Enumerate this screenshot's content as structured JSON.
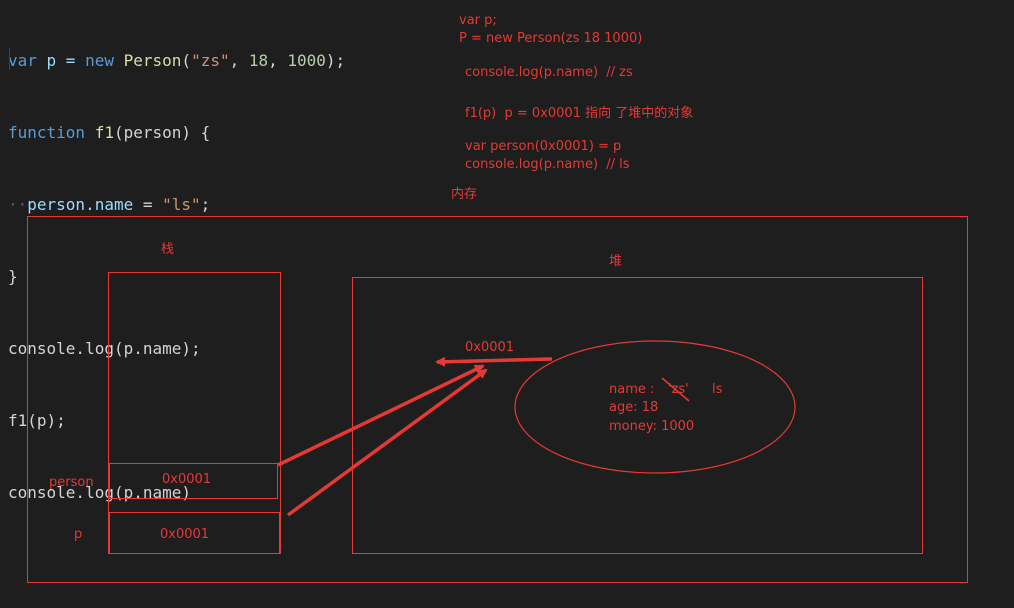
{
  "code": {
    "line1": {
      "kw1": "var",
      "mid1": " p = ",
      "kw2": "new",
      "sp": " ",
      "fn": "Person",
      "open": "(",
      "str": "\"zs\"",
      "c1": ", ",
      "n1": "18",
      "c2": ", ",
      "n2": "1000",
      "close": ");"
    },
    "line2": {
      "kw": "function",
      "sp": " ",
      "fn": "f1",
      "rest": "(person) {"
    },
    "line3": {
      "dots": "··",
      "obj": "person.name",
      "eq": " = ",
      "str": "\"ls\"",
      "end": ";"
    },
    "line4": "}",
    "line5": "console.log(p.name);",
    "line6": "f1(p);",
    "line7": "console.log(p.name)"
  },
  "notes": {
    "n1": "var p;",
    "n2": "P = new Person(zs 18 1000)",
    "n3": "console.log(p.name)  // zs",
    "n4": "f1(p)  p = 0x0001 指向 了堆中的对象",
    "n5": "var person(0x0001) = p",
    "n6": "console.log(p.name)  // ls",
    "memory": "内存"
  },
  "diagram": {
    "stack_label": "栈",
    "heap_label": "堆",
    "person_label": "person",
    "p_label": "p",
    "person_value": "0x0001",
    "p_value": "0x0001",
    "address_label": "0x0001",
    "object": {
      "name_key": "name :",
      "name_old": "'zs'",
      "name_new": "ls",
      "age": "age: 18",
      "money": "money: 1000"
    }
  },
  "colors": {
    "annotation": "#e53935",
    "background": "#1e1e1e"
  }
}
